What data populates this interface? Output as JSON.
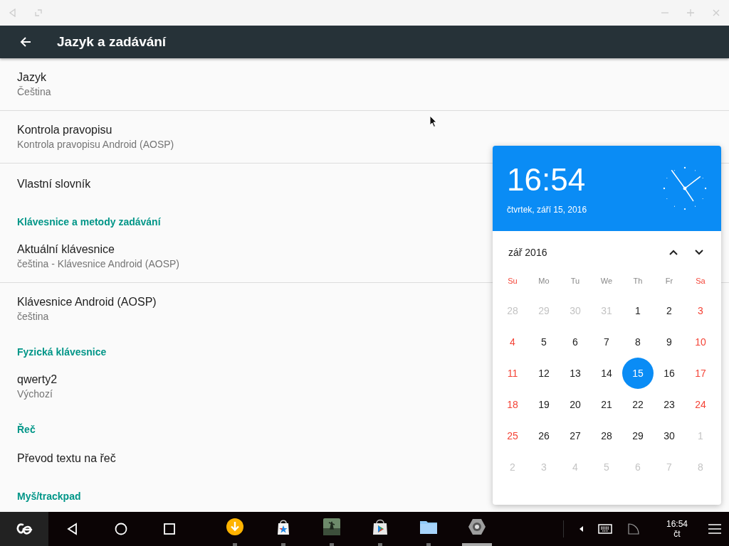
{
  "app_bar": {
    "title": "Jazyk a zadávání"
  },
  "settings": [
    {
      "kind": "item",
      "title": "Jazyk",
      "summary": "Čeština",
      "divider": true
    },
    {
      "kind": "item",
      "title": "Kontrola pravopisu",
      "summary": "Kontrola pravopisu Android (AOSP)",
      "divider": true
    },
    {
      "kind": "item",
      "title": "Vlastní slovník",
      "divider": false
    },
    {
      "kind": "header",
      "title": "Klávesnice a metody zadávání"
    },
    {
      "kind": "item",
      "title": "Aktuální klávesnice",
      "summary": "čeština - Klávesnice Android (AOSP)",
      "divider": true
    },
    {
      "kind": "item",
      "title": "Klávesnice Android (AOSP)",
      "summary": "čeština",
      "divider": false
    },
    {
      "kind": "header",
      "title": "Fyzická klávesnice"
    },
    {
      "kind": "item",
      "title": "qwerty2",
      "summary": "Výchozí",
      "divider": false
    },
    {
      "kind": "header",
      "title": "Řeč"
    },
    {
      "kind": "item",
      "title": "Převod textu na řeč",
      "divider": false
    },
    {
      "kind": "header",
      "title": "Myš/trackpad"
    }
  ],
  "calendar_popup": {
    "time": "16:54",
    "date": "čtvrtek, září 15, 2016",
    "month": "zář 2016",
    "weekdays": [
      {
        "label": "Su",
        "weekend": true
      },
      {
        "label": "Mo",
        "weekend": false
      },
      {
        "label": "Tu",
        "weekend": false
      },
      {
        "label": "We",
        "weekend": false
      },
      {
        "label": "Th",
        "weekend": false
      },
      {
        "label": "Fr",
        "weekend": false
      },
      {
        "label": "Sa",
        "weekend": true
      }
    ],
    "days": [
      {
        "label": "28",
        "kind": "other",
        "selected": false
      },
      {
        "label": "29",
        "kind": "other",
        "selected": false
      },
      {
        "label": "30",
        "kind": "other",
        "selected": false
      },
      {
        "label": "31",
        "kind": "other",
        "selected": false
      },
      {
        "label": "1",
        "kind": "normal",
        "selected": false
      },
      {
        "label": "2",
        "kind": "normal",
        "selected": false
      },
      {
        "label": "3",
        "kind": "weekend",
        "selected": false
      },
      {
        "label": "4",
        "kind": "weekend",
        "selected": false
      },
      {
        "label": "5",
        "kind": "normal",
        "selected": false
      },
      {
        "label": "6",
        "kind": "normal",
        "selected": false
      },
      {
        "label": "7",
        "kind": "normal",
        "selected": false
      },
      {
        "label": "8",
        "kind": "normal",
        "selected": false
      },
      {
        "label": "9",
        "kind": "normal",
        "selected": false
      },
      {
        "label": "10",
        "kind": "weekend",
        "selected": false
      },
      {
        "label": "11",
        "kind": "weekend",
        "selected": false
      },
      {
        "label": "12",
        "kind": "normal",
        "selected": false
      },
      {
        "label": "13",
        "kind": "normal",
        "selected": false
      },
      {
        "label": "14",
        "kind": "normal",
        "selected": false
      },
      {
        "label": "15",
        "kind": "normal",
        "selected": true
      },
      {
        "label": "16",
        "kind": "normal",
        "selected": false
      },
      {
        "label": "17",
        "kind": "weekend",
        "selected": false
      },
      {
        "label": "18",
        "kind": "weekend",
        "selected": false
      },
      {
        "label": "19",
        "kind": "normal",
        "selected": false
      },
      {
        "label": "20",
        "kind": "normal",
        "selected": false
      },
      {
        "label": "21",
        "kind": "normal",
        "selected": false
      },
      {
        "label": "22",
        "kind": "normal",
        "selected": false
      },
      {
        "label": "23",
        "kind": "normal",
        "selected": false
      },
      {
        "label": "24",
        "kind": "weekend",
        "selected": false
      },
      {
        "label": "25",
        "kind": "weekend",
        "selected": false
      },
      {
        "label": "26",
        "kind": "normal",
        "selected": false
      },
      {
        "label": "27",
        "kind": "normal",
        "selected": false
      },
      {
        "label": "28",
        "kind": "normal",
        "selected": false
      },
      {
        "label": "29",
        "kind": "normal",
        "selected": false
      },
      {
        "label": "30",
        "kind": "normal",
        "selected": false
      },
      {
        "label": "1",
        "kind": "other",
        "selected": false
      },
      {
        "label": "2",
        "kind": "other",
        "selected": false
      },
      {
        "label": "3",
        "kind": "other",
        "selected": false
      },
      {
        "label": "4",
        "kind": "other",
        "selected": false
      },
      {
        "label": "5",
        "kind": "other",
        "selected": false
      },
      {
        "label": "6",
        "kind": "other",
        "selected": false
      },
      {
        "label": "7",
        "kind": "other",
        "selected": false
      },
      {
        "label": "8",
        "kind": "other",
        "selected": false
      }
    ]
  },
  "taskbar": {
    "apps": [
      {
        "kind": "download",
        "active": false
      },
      {
        "kind": "store",
        "active": false
      },
      {
        "kind": "game",
        "active": false
      },
      {
        "kind": "play",
        "active": false
      },
      {
        "kind": "folder",
        "active": false
      },
      {
        "kind": "settings",
        "active": true
      }
    ],
    "clock": {
      "time": "16:54",
      "day": "čt"
    }
  }
}
